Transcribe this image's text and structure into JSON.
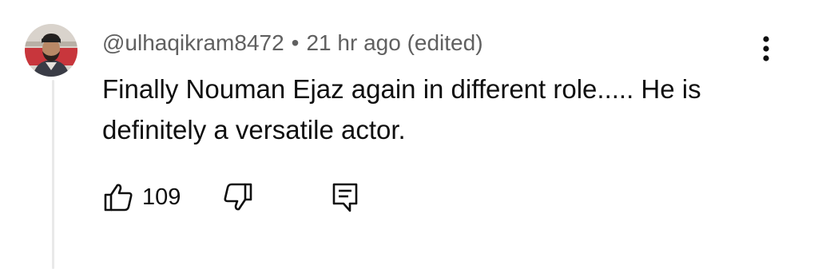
{
  "comment": {
    "author": "@ulhaqikram8472",
    "separator": "•",
    "timestamp": "21 hr ago (edited)",
    "text": "Finally Nouman Ejaz again in different role..... He is definitely a versatile actor.",
    "avatar_alt": "profile picture of ulhaqikram8472"
  },
  "actions": {
    "like_count": "109",
    "like_icon": "thumbs-up-icon",
    "dislike_icon": "thumbs-down-icon",
    "reply_icon": "reply-comment-icon",
    "more_icon": "three-dot-vertical-icon"
  },
  "colors": {
    "text_primary": "#0f0f0f",
    "text_secondary": "#606060",
    "thread_line": "#e9e9e9"
  }
}
